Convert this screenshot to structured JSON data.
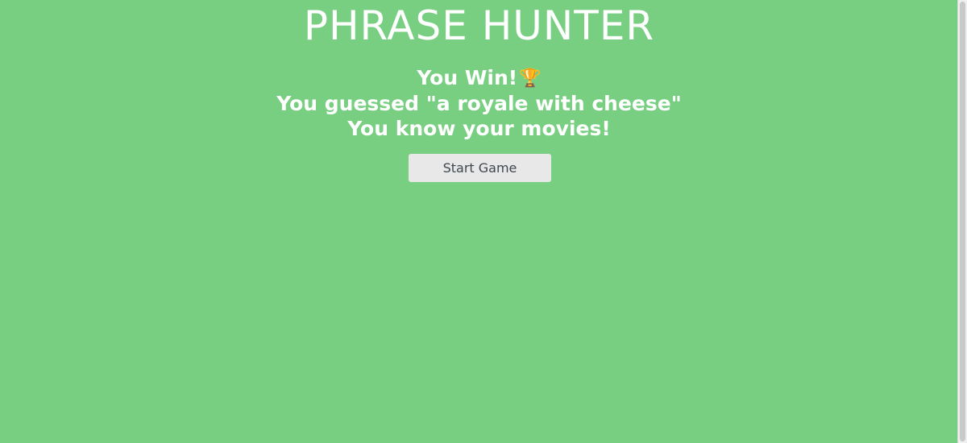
{
  "game": {
    "title": "PHRASE HUNTER"
  },
  "result": {
    "win_text": "You Win!",
    "trophy_icon": "🏆",
    "guessed_text": "You guessed \"a royale with cheese\"",
    "praise_text": "You know your movies!"
  },
  "controls": {
    "start_button_label": "Start Game"
  },
  "colors": {
    "background": "#78cf82",
    "text": "#ffffff",
    "button_background": "#e8e8e8",
    "button_text": "#3f4750"
  },
  "icons": {
    "trophy": "trophy-icon"
  }
}
